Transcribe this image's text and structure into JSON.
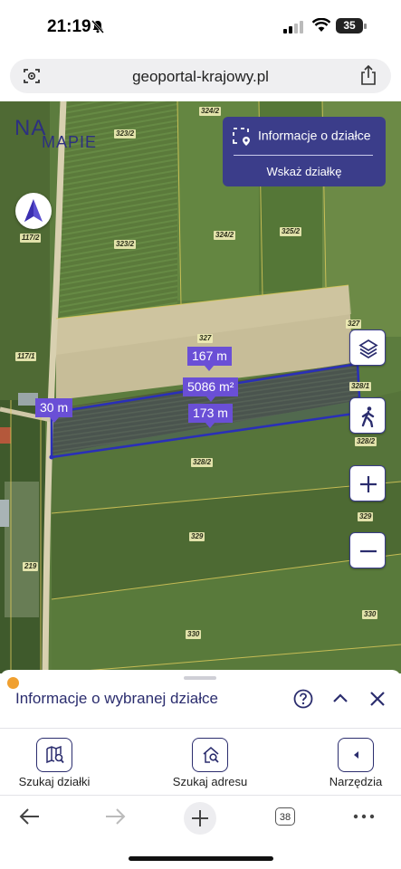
{
  "status": {
    "time": "21:19",
    "battery": "35"
  },
  "browser": {
    "url": "geoportal-krajowy.pl",
    "tab_count": "38"
  },
  "map": {
    "logo_top": "NA",
    "logo_bottom": "MAPIE",
    "info_panel": {
      "title": "Informacje o działce",
      "action": "Wskaż działkę"
    },
    "parcels": [
      "324/2",
      "323/2",
      "323/2",
      "324/2",
      "325/2",
      "117/2",
      "117/1",
      "327",
      "327",
      "328/1",
      "328/2",
      "328/2",
      "329",
      "329",
      "219",
      "330",
      "330"
    ],
    "measurements": {
      "length_top": "167 m",
      "area": "5086 m²",
      "length_bottom": "173 m",
      "width_left": "30 m"
    }
  },
  "sheet": {
    "title": "Informacje o wybranej działce"
  },
  "tools": {
    "search_parcel": "Szukaj działki",
    "search_address": "Szukaj adresu",
    "tools_label": "Narzędzia"
  },
  "colors": {
    "accent": "#3b3d8a",
    "measure": "#6a4fd6",
    "parcel_outline": "#2a2fb8"
  }
}
